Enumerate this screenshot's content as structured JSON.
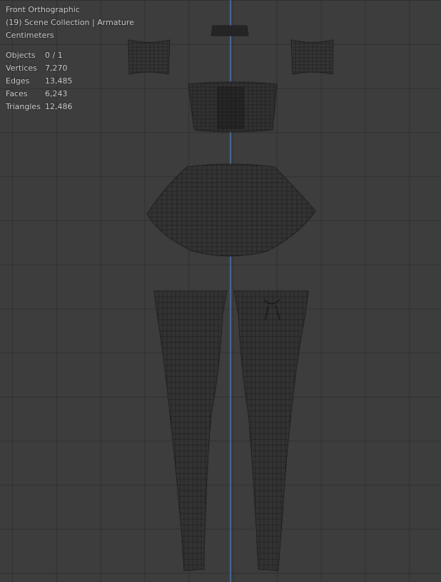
{
  "viewport": {
    "view_name": "Front Orthographic",
    "collection_line": "(19) Scene Collection | Armature",
    "units": "Centimeters",
    "colors": {
      "background": "#3d3d3d",
      "grid": "#333333",
      "z_axis": "#4b6ea3",
      "wire": "#111111"
    }
  },
  "stats": [
    {
      "label": "Objects",
      "value": "0 / 1"
    },
    {
      "label": "Vertices",
      "value": "7,270"
    },
    {
      "label": "Edges",
      "value": "13,485"
    },
    {
      "label": "Faces",
      "value": "6,243"
    },
    {
      "label": "Triangles",
      "value": "12,486"
    }
  ]
}
